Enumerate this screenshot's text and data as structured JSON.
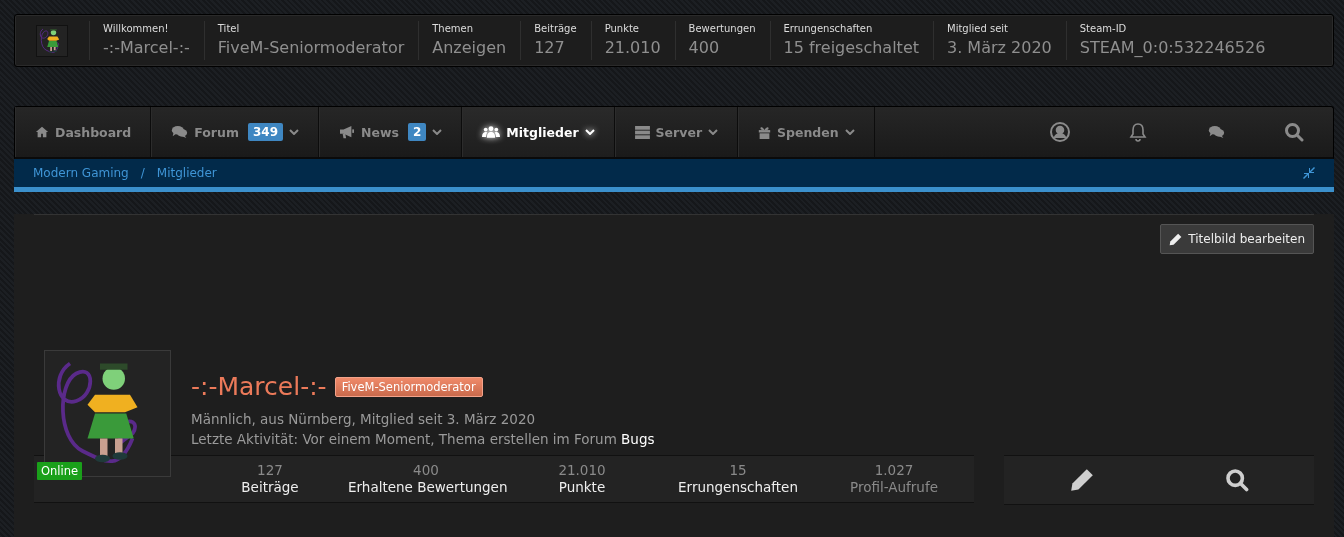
{
  "user_bar": {
    "stats": [
      {
        "label": "Willkommen!",
        "value": "-:-Marcel-:-"
      },
      {
        "label": "Titel",
        "value": "FiveM-Seniormoderator"
      },
      {
        "label": "Themen",
        "value": "Anzeigen"
      },
      {
        "label": "Beiträge",
        "value": "127"
      },
      {
        "label": "Punkte",
        "value": "21.010"
      },
      {
        "label": "Bewertungen",
        "value": "400"
      },
      {
        "label": "Errungenschaften",
        "value": "15 freigeschaltet"
      },
      {
        "label": "Mitglied seit",
        "value": "3. März 2020"
      },
      {
        "label": "Steam-ID",
        "value": "STEAM_0:0:532246526"
      }
    ]
  },
  "nav": {
    "items": [
      {
        "label": "Dashboard",
        "selected": false,
        "has_menu": false
      },
      {
        "label": "Forum",
        "badge": "349",
        "selected": false,
        "has_menu": true
      },
      {
        "label": "News",
        "badge": "2",
        "selected": false,
        "has_menu": true
      },
      {
        "label": "Mitglieder",
        "selected": true,
        "has_menu": true
      },
      {
        "label": "Server",
        "selected": false,
        "has_menu": true
      },
      {
        "label": "Spenden",
        "selected": false,
        "has_menu": true
      }
    ]
  },
  "breadcrumbs": {
    "items": [
      "Modern Gaming",
      "Mitglieder"
    ],
    "separator": "/"
  },
  "profile": {
    "cover_button": "Titelbild bearbeiten",
    "status": "Online",
    "name": "-:-Marcel-:-",
    "rank": "FiveM-Seniormoderator",
    "info": "Männlich, aus Nürnberg, Mitglied seit 3. März 2020",
    "activity": "Letzte Aktivität: Vor einem Moment, Thema erstellen im Forum ",
    "activity_link": "Bugs",
    "stats": [
      {
        "value": "127",
        "label": "Beiträge",
        "muted": false
      },
      {
        "value": "400",
        "label": "Erhaltene Bewertungen",
        "muted": false
      },
      {
        "value": "21.010",
        "label": "Punkte",
        "muted": false
      },
      {
        "value": "15",
        "label": "Errungenschaften",
        "muted": false
      },
      {
        "value": "1.027",
        "label": "Profil-Aufrufe",
        "muted": true
      }
    ]
  }
}
